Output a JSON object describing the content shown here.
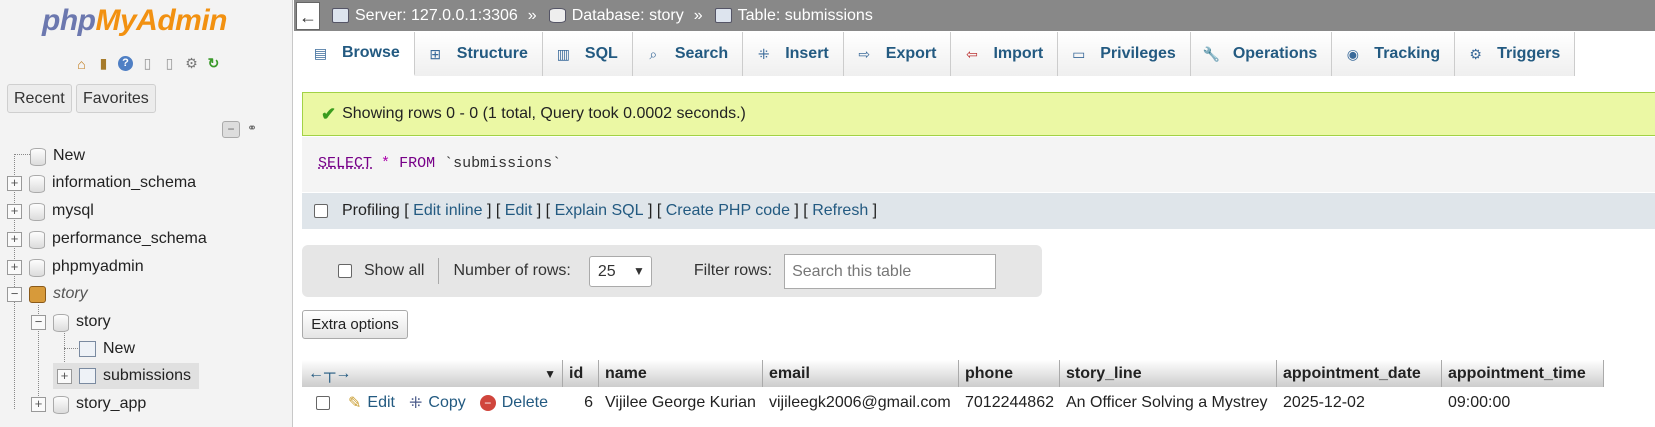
{
  "logo": {
    "php": "php",
    "my": "My",
    "admin": "Admin"
  },
  "nav": {
    "recent_label": "Recent",
    "favorites_label": "Favorites",
    "tree": [
      {
        "label": "New"
      },
      {
        "label": "information_schema"
      },
      {
        "label": "mysql"
      },
      {
        "label": "performance_schema"
      },
      {
        "label": "phpmyadmin"
      },
      {
        "label": "story"
      },
      {
        "label": "story"
      },
      {
        "label": "New"
      },
      {
        "label": "submissions"
      },
      {
        "label": "story_app"
      }
    ]
  },
  "breadcrumb": {
    "server": "Server: 127.0.0.1:3306",
    "database": "Database: story",
    "table": "Table: submissions",
    "separator": "»"
  },
  "tabs": [
    {
      "label": "Browse",
      "icon": "browse-icon"
    },
    {
      "label": "Structure",
      "icon": "structure-icon"
    },
    {
      "label": "SQL",
      "icon": "sql-icon"
    },
    {
      "label": "Search",
      "icon": "search-icon"
    },
    {
      "label": "Insert",
      "icon": "insert-icon"
    },
    {
      "label": "Export",
      "icon": "export-icon"
    },
    {
      "label": "Import",
      "icon": "import-icon"
    },
    {
      "label": "Privileges",
      "icon": "privileges-icon"
    },
    {
      "label": "Operations",
      "icon": "operations-icon"
    },
    {
      "label": "Tracking",
      "icon": "tracking-icon"
    },
    {
      "label": "Triggers",
      "icon": "triggers-icon"
    }
  ],
  "message": {
    "success": "Showing rows 0 - 0 (1 total, Query took 0.0002 seconds.)"
  },
  "query": {
    "select": "SELECT",
    "star": "*",
    "from": "FROM",
    "table": "`submissions`"
  },
  "profiling": {
    "label": "Profiling",
    "edit_inline": "Edit inline",
    "edit": "Edit",
    "explain": "Explain SQL",
    "create_php": "Create PHP code",
    "refresh": "Refresh"
  },
  "filter": {
    "show_all": "Show all",
    "rows_label": "Number of rows:",
    "rows_value": "25",
    "filter_label": "Filter rows:",
    "filter_placeholder": "Search this table"
  },
  "extra_options": "Extra options",
  "results": {
    "columns": [
      "id",
      "name",
      "email",
      "phone",
      "story_line",
      "appointment_date",
      "appointment_time"
    ],
    "actions": {
      "edit": "Edit",
      "copy": "Copy",
      "delete": "Delete"
    },
    "rows": [
      [
        "6",
        "Vijilee George Kurian",
        "vijileegk2006@gmail.com",
        "7012244862",
        "An Officer Solving a Mystrey",
        "2025-12-02",
        "09:00:00"
      ]
    ]
  },
  "colors": {
    "success_bg": "#ebf8a4",
    "link": "#235a81",
    "topbar": "#888888"
  }
}
